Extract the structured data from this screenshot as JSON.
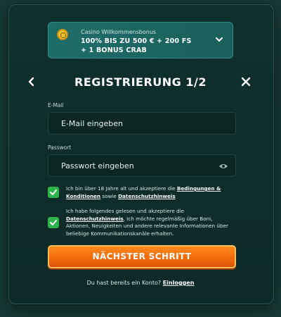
{
  "bonus": {
    "title": "Casino Willkommensbonus",
    "line1": "100% BIS ZU 500 € + 200 FS",
    "line2": "+ 1 BONUS CRAB"
  },
  "header": {
    "title": "REGISTRIERUNG 1/2"
  },
  "email": {
    "label": "E-Mail",
    "placeholder": "E-Mail eingeben"
  },
  "password": {
    "label": "Passwort",
    "placeholder": "Passwort eingeben"
  },
  "consent_age": {
    "checked": true,
    "text_before": "Ich bin über 18 Jahre alt und akzeptiere die ",
    "link1": "Bedingungen & Konditionen",
    "text_middle": " sowie ",
    "link2": "Datenschutzhinweis"
  },
  "consent_marketing": {
    "checked": true,
    "text_before": "Ich habe folgendes gelesen und akzeptiere die ",
    "link": "Datenschutzhinweis",
    "text_after": ", Ich möchte regelmäßig über Boni, Aktionen, Neuigkeiten und andere relevante Informationen über beliebige Kommunikationskanäle erhalten."
  },
  "cta": {
    "label": "NÄCHSTER SCHRITT"
  },
  "login": {
    "text": "Du hast bereits ein Konto? ",
    "link": "Einloggen"
  },
  "colors": {
    "accent": "#f26b0c",
    "check": "#2cb34a",
    "panel": "#0f2f2d",
    "bonus_bg": "#1e6d69"
  }
}
